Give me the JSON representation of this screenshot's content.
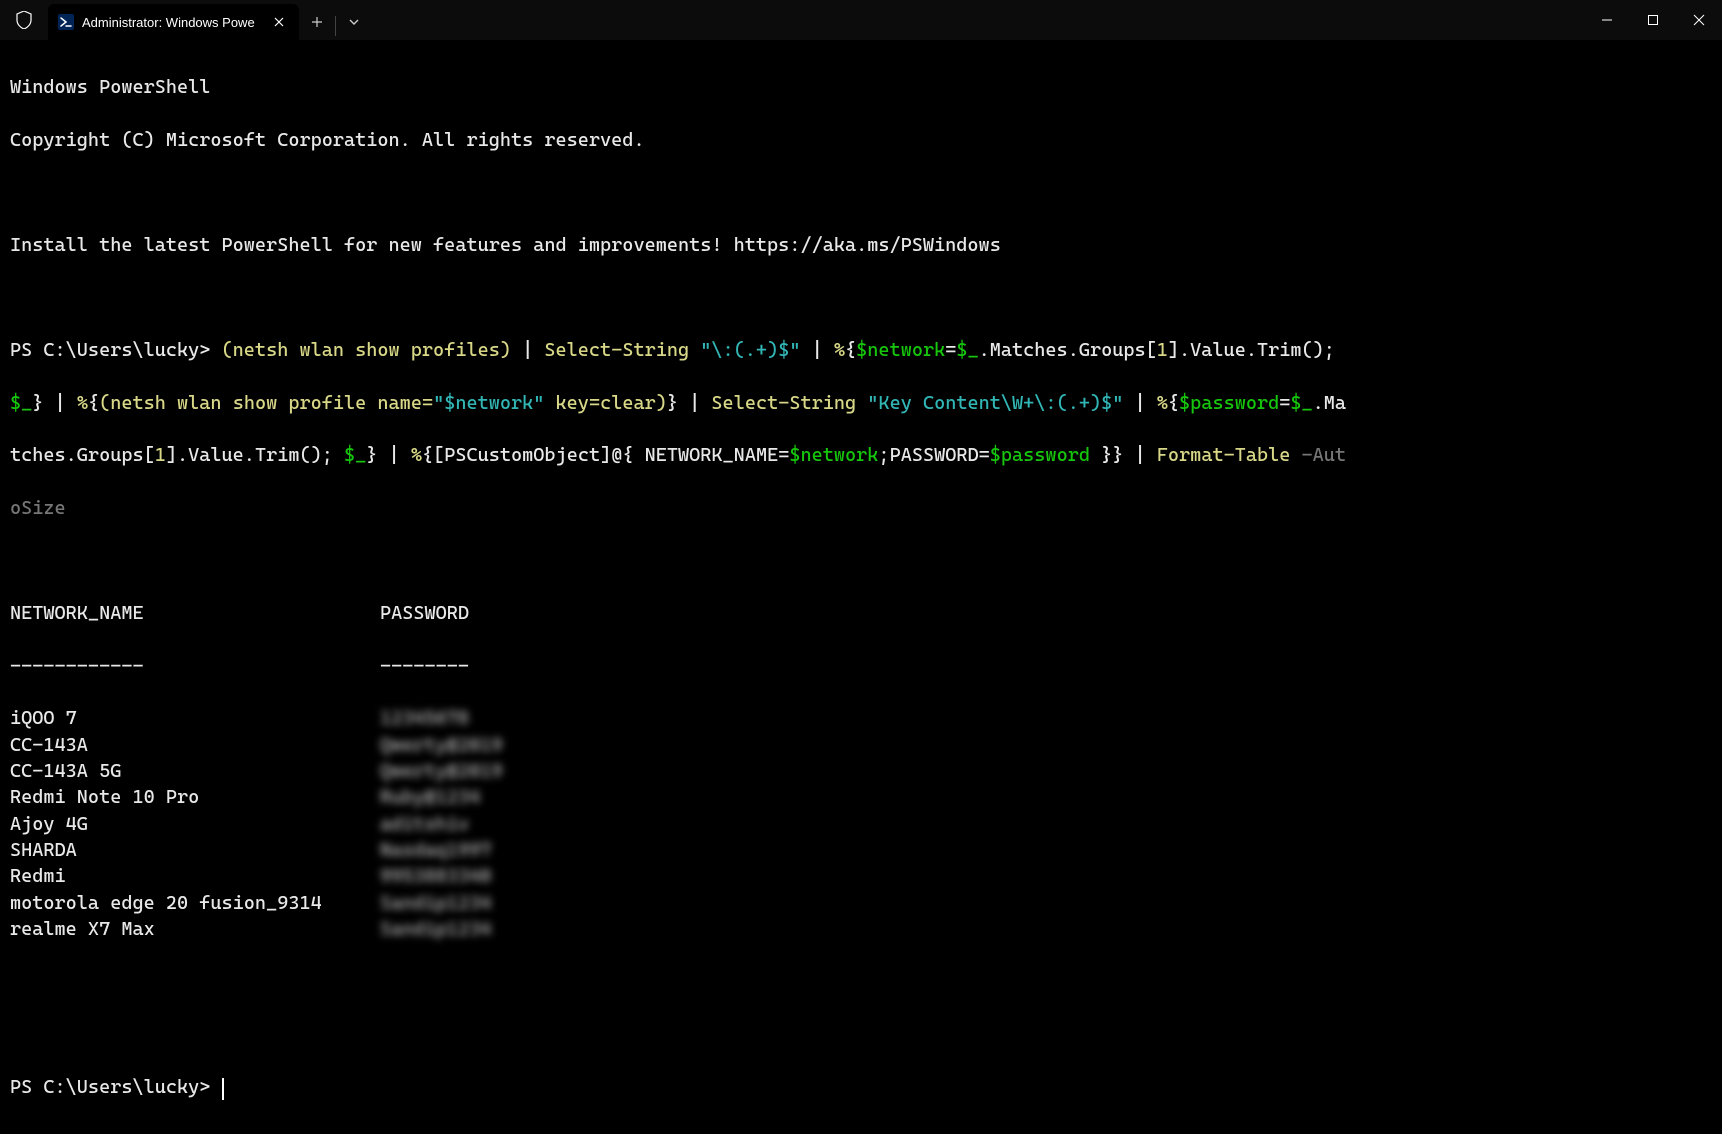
{
  "titlebar": {
    "tab_title": "Administrator: Windows Powe",
    "tab_icon_name": "powershell-icon"
  },
  "terminal": {
    "banner_line1": "Windows PowerShell",
    "banner_line2": "Copyright (C) Microsoft Corporation. All rights reserved.",
    "banner_line3": "Install the latest PowerShell for new features and improvements! https://aka.ms/PSWindows",
    "prompt": "PS C:\\Users\\lucky>",
    "command": {
      "part01": "(netsh wlan show profiles)",
      "part01a": " | ",
      "part02": "Select-String",
      "part02a": " ",
      "part03": "\"\\:(.+)$\"",
      "part03a": " | ",
      "part04_pct": "%",
      "part04_brace": "{",
      "part05_var": "$network",
      "part05_eq": "=",
      "part05_var2": "$_",
      "part05_rest": ".Matches.Groups[",
      "part05_idx": "1",
      "part05_rest2": "].Value.Trim();",
      "part06_nl_var": "$_",
      "part06_brace": "}",
      "part06a": " | ",
      "part07_pct": "%",
      "part07_brace": "{",
      "part07_cmd": "(netsh wlan show profile name=",
      "part07_str": "\"$network\"",
      "part07_cmd2": " key=clear)",
      "part07_brace2": "}",
      "part07a": " | ",
      "part08": "Select-String",
      "part08a": " ",
      "part09": "\"Key Content\\W+\\:(.+)$\"",
      "part09a": " | ",
      "part10_pct": "%",
      "part10_brace": "{",
      "part10_var": "$password",
      "part10_eq": "=",
      "part10_var2": "$_",
      "part10_rest": ".Ma",
      "part11_rest": "tches.Groups[",
      "part11_idx": "1",
      "part11_rest2": "].Value.Trim(); ",
      "part11_var": "$_",
      "part11_brace": "}",
      "part11a": " | ",
      "part12_pct": "%",
      "part12_brace": "{",
      "part12_obj": "[PSCustomObject]@{ NETWORK_NAME",
      "part12_eq": "=",
      "part12_var1": "$network",
      "part12_semi": ";",
      "part12_pwd": "PASSWORD",
      "part12_eq2": "=",
      "part12_var2": "$password",
      "part12_end": " }",
      "part12_brace2": "}",
      "part12a": " | ",
      "part13": "Format-Table",
      "part13a": " ",
      "part14": "-Aut",
      "part15": "oSize"
    },
    "table": {
      "header_net": "NETWORK_NAME",
      "header_pwd": "PASSWORD",
      "sep_net": "------------",
      "sep_pwd": "--------",
      "rows": [
        {
          "net": "iQOO 7",
          "pwd": "12345678"
        },
        {
          "net": "CC-143A",
          "pwd": "Qwerty@2019"
        },
        {
          "net": "CC-143A 5G",
          "pwd": "Qwerty@2019"
        },
        {
          "net": "Redmi Note 10 Pro",
          "pwd": "Ruby@1234"
        },
        {
          "net": "Ajoy 4G",
          "pwd": "aditshiv"
        },
        {
          "net": "SHARDA",
          "pwd": "Nasdaq1997"
        },
        {
          "net": "Redmi",
          "pwd": "9953883340"
        },
        {
          "net": "motorola edge 20 fusion_9314",
          "pwd": "Sandip1234"
        },
        {
          "net": "realme X7 Max",
          "pwd": "Sandip1234"
        }
      ]
    },
    "prompt2": "PS C:\\Users\\lucky>"
  }
}
